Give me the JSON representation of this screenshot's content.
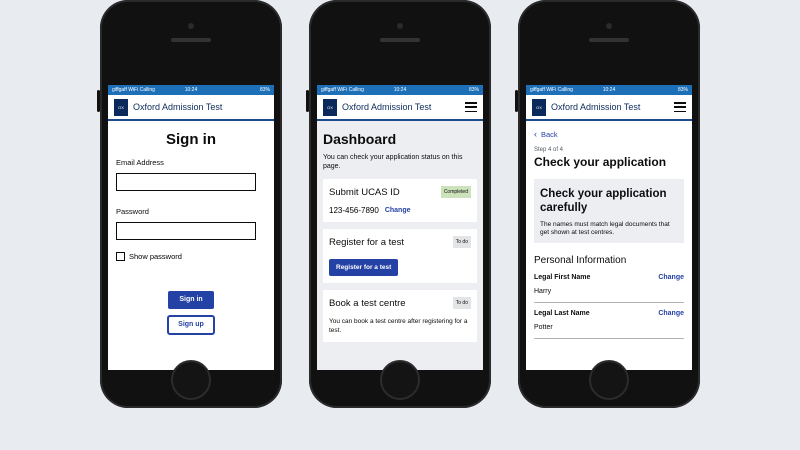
{
  "status": {
    "carrier": "giffgaff WiFi Calling",
    "time": "10:24",
    "battery": "83%"
  },
  "app": {
    "title": "Oxford Admission Test",
    "crest_text": "OXFORD"
  },
  "signin": {
    "heading": "Sign in",
    "email_label": "Email Address",
    "password_label": "Password",
    "show_password": "Show password",
    "signin_button": "Sign in",
    "signup_button": "Sign up"
  },
  "dashboard": {
    "heading": "Dashboard",
    "intro": "You can check your application status on this page.",
    "cards": [
      {
        "title": "Submit UCAS ID",
        "tag": "Completed",
        "value": "123-456-7890",
        "link": "Change"
      },
      {
        "title": "Register for a test",
        "tag": "To do",
        "button": "Register for a test"
      },
      {
        "title": "Book a test centre",
        "tag": "To do",
        "body": "You can book a test centre after registering for a test."
      }
    ]
  },
  "check": {
    "back": "Back",
    "step": "Step 4 of 4",
    "heading": "Check your application",
    "panel_heading": "Check your application carefully",
    "panel_body": "The names must match legal documents that get shown at test centres.",
    "section": "Personal Information",
    "rows": [
      {
        "label": "Legal First Name",
        "value": "Harry",
        "change": "Change"
      },
      {
        "label": "Legal Last Name",
        "value": "Potter",
        "change": "Change"
      }
    ]
  }
}
